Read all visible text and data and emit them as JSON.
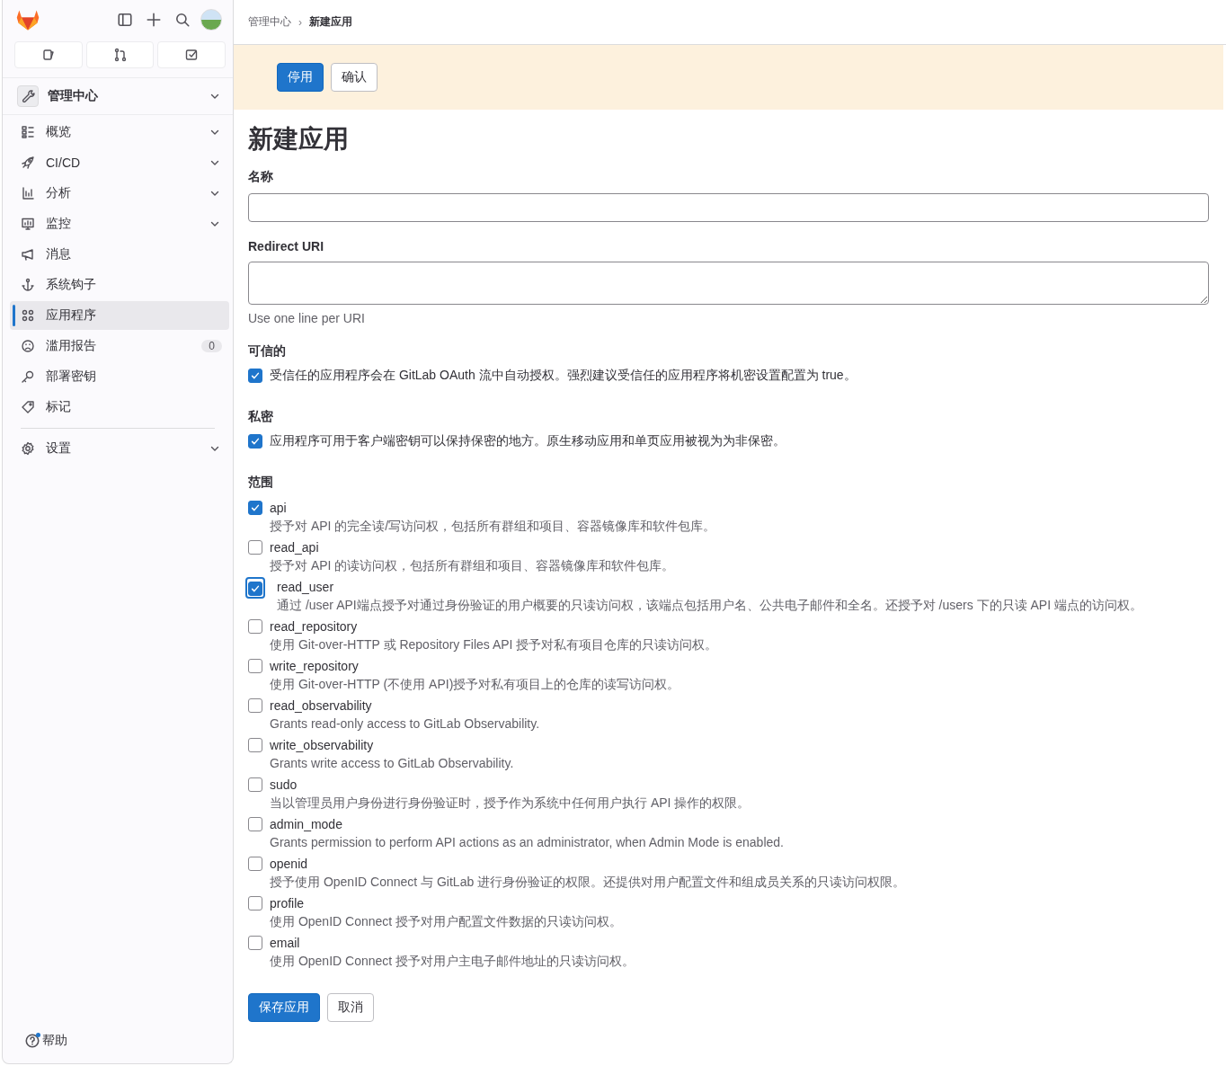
{
  "sidebar": {
    "context": {
      "label": "管理中心",
      "expanded": false
    },
    "items": [
      {
        "label": "概览",
        "has_submenu": true,
        "selected": false
      },
      {
        "label": "CI/CD",
        "has_submenu": true,
        "selected": false
      },
      {
        "label": "分析",
        "has_submenu": true,
        "selected": false
      },
      {
        "label": "监控",
        "has_submenu": true,
        "selected": false
      },
      {
        "label": "消息",
        "has_submenu": false,
        "selected": false
      },
      {
        "label": "系统钩子",
        "has_submenu": false,
        "selected": false
      },
      {
        "label": "应用程序",
        "has_submenu": false,
        "selected": true
      },
      {
        "label": "滥用报告",
        "has_submenu": false,
        "selected": false,
        "badge": "0"
      },
      {
        "label": "部署密钥",
        "has_submenu": false,
        "selected": false
      },
      {
        "label": "标记",
        "has_submenu": false,
        "selected": false
      }
    ],
    "settings": {
      "label": "设置",
      "has_submenu": true
    },
    "help": {
      "label": "帮助",
      "notification": true
    }
  },
  "breadcrumb_separator": "›",
  "breadcrumbs": [
    {
      "label": "管理中心",
      "current": false
    },
    {
      "label": "新建应用",
      "current": true
    }
  ],
  "banner": {
    "buttons": [
      {
        "label": "停用",
        "kind": "primary"
      },
      {
        "label": "确认",
        "kind": "default"
      }
    ]
  },
  "page_title": "新建应用",
  "form": {
    "name_label": "名称",
    "redirect_label": "Redirect URI",
    "redirect_help": "Use one line per URI",
    "trusted": {
      "heading": "可信的",
      "checked": true,
      "text": "受信任的应用程序会在 GitLab OAuth 流中自动授权。强烈建议受信任的应用程序将机密设置配置为 true。"
    },
    "confidential": {
      "heading": "私密",
      "checked": true,
      "text": "应用程序可用于客户端密钥可以保持保密的地方。原生移动应用和单页应用被视为为非保密。"
    },
    "scopes_heading": "范围",
    "scopes": [
      {
        "name": "api",
        "description": "授予对 API 的完全读/写访问权，包括所有群组和项目、容器镜像库和软件包库。",
        "checked": true,
        "focused": false
      },
      {
        "name": "read_api",
        "description": "授予对 API 的读访问权，包括所有群组和项目、容器镜像库和软件包库。",
        "checked": false,
        "focused": false
      },
      {
        "name": "read_user",
        "description": "通过 /user API端点授予对通过身份验证的用户概要的只读访问权，该端点包括用户名、公共电子邮件和全名。还授予对 /users 下的只读 API 端点的访问权。",
        "checked": true,
        "focused": true
      },
      {
        "name": "read_repository",
        "description": "使用 Git-over-HTTP 或 Repository Files API 授予对私有项目仓库的只读访问权。",
        "checked": false,
        "focused": false
      },
      {
        "name": "write_repository",
        "description": "使用 Git-over-HTTP (不使用 API)授予对私有项目上的仓库的读写访问权。",
        "checked": false,
        "focused": false
      },
      {
        "name": "read_observability",
        "description": "Grants read-only access to GitLab Observability.",
        "checked": false,
        "focused": false
      },
      {
        "name": "write_observability",
        "description": "Grants write access to GitLab Observability.",
        "checked": false,
        "focused": false
      },
      {
        "name": "sudo",
        "description": "当以管理员用户身份进行身份验证时，授予作为系统中任何用户执行 API 操作的权限。",
        "checked": false,
        "focused": false
      },
      {
        "name": "admin_mode",
        "description": "Grants permission to perform API actions as an administrator, when Admin Mode is enabled.",
        "checked": false,
        "focused": false
      },
      {
        "name": "openid",
        "description": "授予使用 OpenID Connect 与 GitLab 进行身份验证的权限。还提供对用户配置文件和组成员关系的只读访问权限。",
        "checked": false,
        "focused": false
      },
      {
        "name": "profile",
        "description": "使用 OpenID Connect 授予对用户配置文件数据的只读访问权。",
        "checked": false,
        "focused": false
      },
      {
        "name": "email",
        "description": "使用 OpenID Connect 授予对用户主电子邮件地址的只读访问权。",
        "checked": false,
        "focused": false
      }
    ],
    "buttons": [
      {
        "label": "保存应用",
        "kind": "primary"
      },
      {
        "label": "取消",
        "kind": "default"
      }
    ]
  }
}
